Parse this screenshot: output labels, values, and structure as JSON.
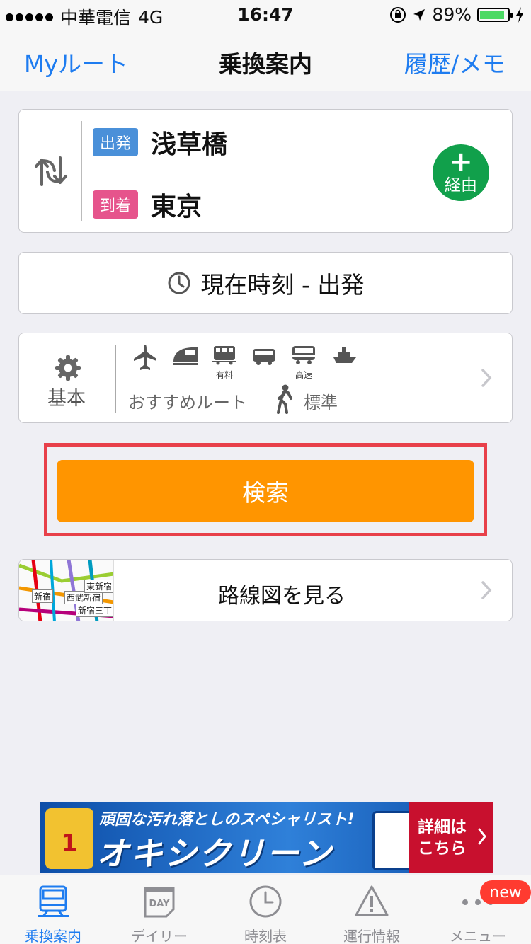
{
  "status_bar": {
    "carrier": "中華電信",
    "network": "4G",
    "time": "16:47",
    "battery": "89%"
  },
  "nav": {
    "left": "Myルート",
    "title": "乗換案内",
    "right": "履歴/メモ"
  },
  "route": {
    "departure_tag": "出発",
    "departure": "浅草橋",
    "arrival_tag": "到着",
    "arrival": "東京",
    "via_plus": "+",
    "via_label": "経由"
  },
  "time": {
    "label": "現在時刻 - 出発"
  },
  "options": {
    "preset": "基本",
    "mode_captions": {
      "paid": "有料",
      "express": "高速"
    },
    "route_type": "おすすめルート",
    "walk_speed": "標準"
  },
  "search": {
    "label": "検索"
  },
  "map": {
    "label": "路線図を見る",
    "thumb_labels": {
      "shinjuku": "新宿",
      "seibu": "西武新宿",
      "higashi": "東新宿",
      "sanchome": "新宿三丁"
    }
  },
  "ad": {
    "line1": "頑固な汚れ落としのスペシャリスト!",
    "line2": "オキシクリーン",
    "badge_num": "1",
    "cta_line1": "詳細は",
    "cta_line2": "こちら"
  },
  "tabbar": {
    "tabs": [
      "乗換案内",
      "デイリー",
      "時刻表",
      "運行情報",
      "メニュー"
    ],
    "day_icon": "DAY",
    "badge": "new"
  },
  "colors": {
    "accent": "#1e7cf0",
    "search": "#ff9500",
    "via": "#11a04b",
    "departure": "#4a90d9",
    "arrival": "#e6548c",
    "highlight": "#e8404a"
  }
}
